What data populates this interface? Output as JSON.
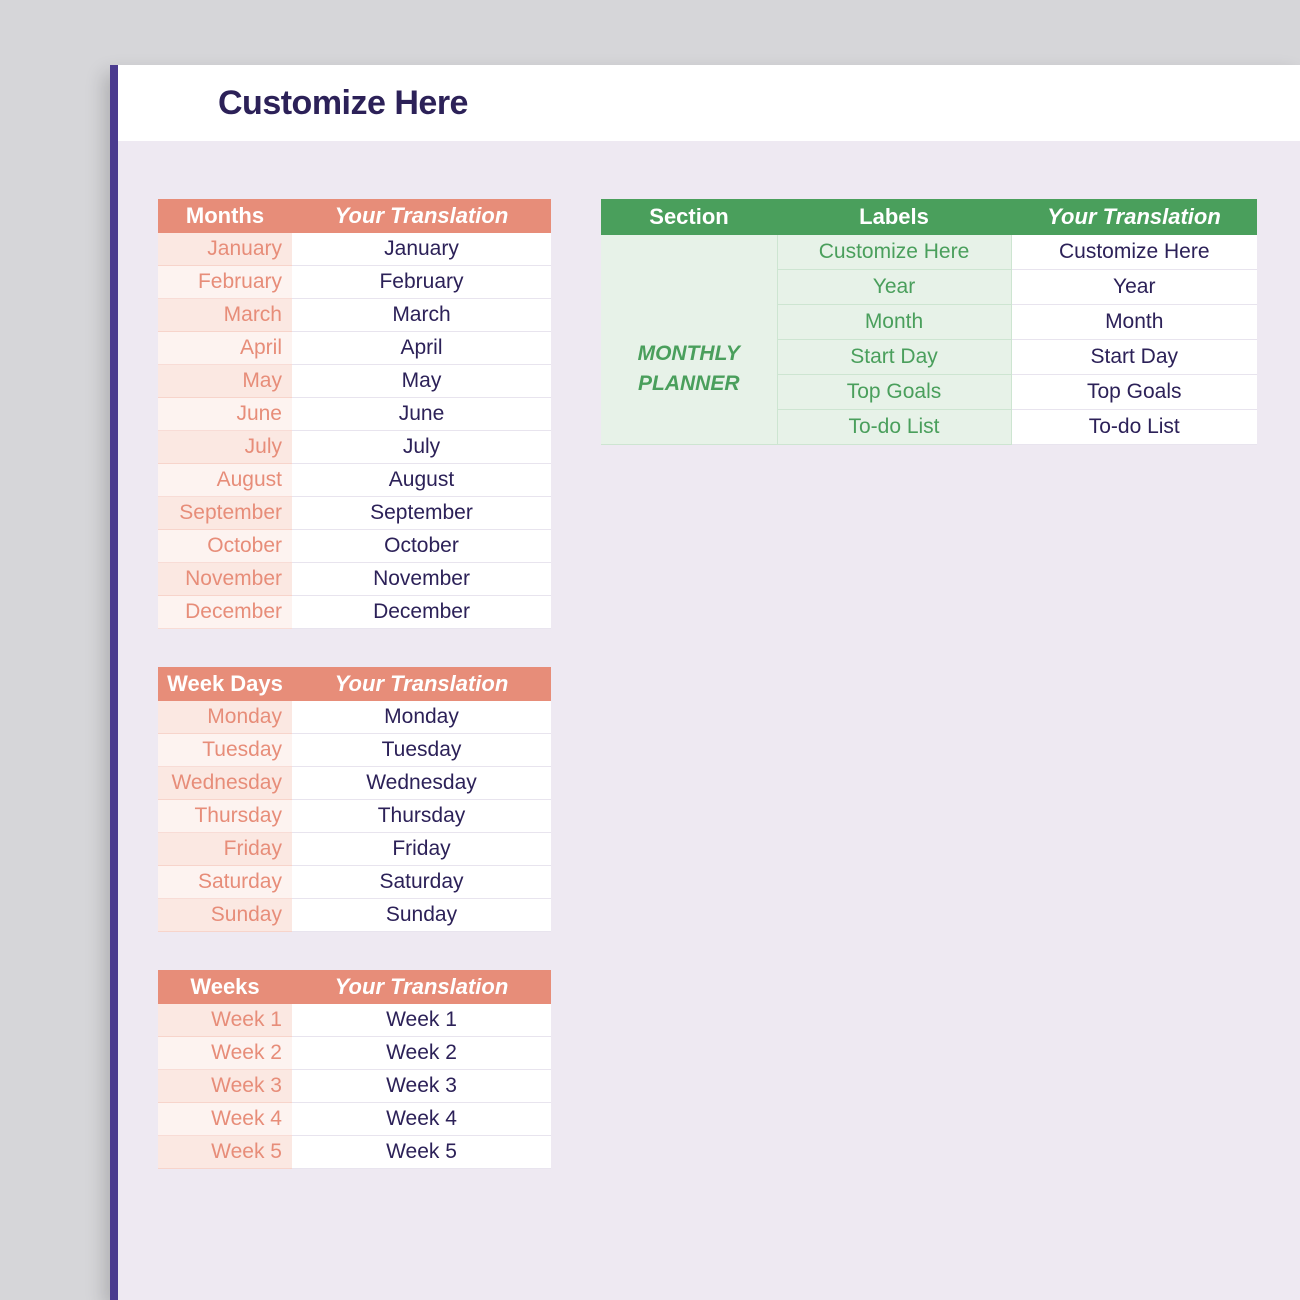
{
  "title": "Customize Here",
  "months_table": {
    "header_key": "Months",
    "header_val": "Your Translation",
    "rows": [
      {
        "key": "January",
        "val": "January"
      },
      {
        "key": "February",
        "val": "February"
      },
      {
        "key": "March",
        "val": "March"
      },
      {
        "key": "April",
        "val": "April"
      },
      {
        "key": "May",
        "val": "May"
      },
      {
        "key": "June",
        "val": "June"
      },
      {
        "key": "July",
        "val": "July"
      },
      {
        "key": "August",
        "val": "August"
      },
      {
        "key": "September",
        "val": "September"
      },
      {
        "key": "October",
        "val": "October"
      },
      {
        "key": "November",
        "val": "November"
      },
      {
        "key": "December",
        "val": "December"
      }
    ]
  },
  "weekdays_table": {
    "header_key": "Week Days",
    "header_val": "Your Translation",
    "rows": [
      {
        "key": "Monday",
        "val": "Monday"
      },
      {
        "key": "Tuesday",
        "val": "Tuesday"
      },
      {
        "key": "Wednesday",
        "val": "Wednesday"
      },
      {
        "key": "Thursday",
        "val": "Thursday"
      },
      {
        "key": "Friday",
        "val": "Friday"
      },
      {
        "key": "Saturday",
        "val": "Saturday"
      },
      {
        "key": "Sunday",
        "val": "Sunday"
      }
    ]
  },
  "weeks_table": {
    "header_key": "Weeks",
    "header_val": "Your Translation",
    "rows": [
      {
        "key": "Week 1",
        "val": "Week 1"
      },
      {
        "key": "Week 2",
        "val": "Week 2"
      },
      {
        "key": "Week 3",
        "val": "Week 3"
      },
      {
        "key": "Week 4",
        "val": "Week 4"
      },
      {
        "key": "Week 5",
        "val": "Week 5"
      }
    ]
  },
  "labels_table": {
    "header_section": "Section",
    "header_label": "Labels",
    "header_val": "Your Translation",
    "section_name_line1": "MONTHLY",
    "section_name_line2": "PLANNER",
    "rows": [
      {
        "label": "Customize Here",
        "val": "Customize Here"
      },
      {
        "label": "Year",
        "val": "Year"
      },
      {
        "label": "Month",
        "val": "Month"
      },
      {
        "label": "Start Day",
        "val": "Start Day"
      },
      {
        "label": "Top Goals",
        "val": "Top Goals"
      },
      {
        "label": "To-do List",
        "val": "To-do List"
      }
    ]
  }
}
